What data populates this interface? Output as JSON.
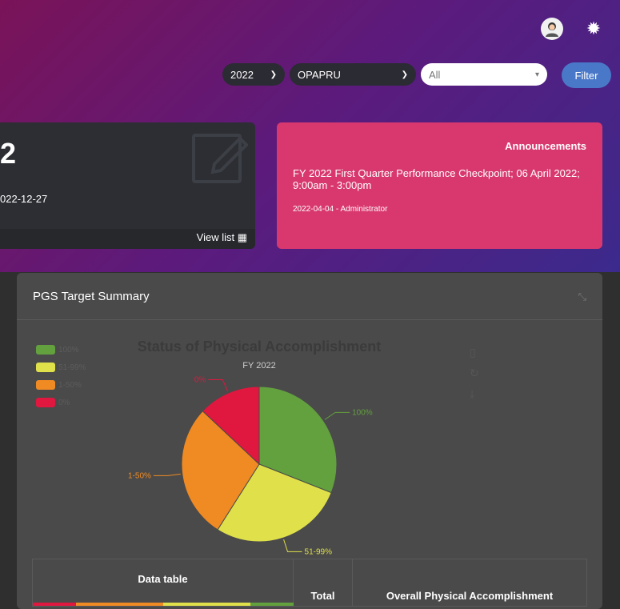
{
  "header": {
    "year_select": "2022",
    "unit_select": "OPAPRU",
    "filter_all": "All",
    "filter_button": "Filter"
  },
  "card_dark": {
    "big_text": "2",
    "date": "022-12-27",
    "view_list": "View list ▦"
  },
  "announcement": {
    "title": "Announcements",
    "message": "FY 2022 First Quarter Performance Checkpoint; 06 April 2022; 9:00am - 3:00pm",
    "meta": "2022-04-04 - Administrator"
  },
  "panel": {
    "title": "PGS Target Summary"
  },
  "chart_data": {
    "type": "pie",
    "title": "Status of Physical Accomplishment",
    "subtitle": "FY 2022",
    "legend": [
      "100%",
      "51-99%",
      "1-50%",
      "0%"
    ],
    "slices": [
      {
        "label": "100%",
        "value": 31,
        "color": "#63a03e"
      },
      {
        "label": "51-99%",
        "value": 28,
        "color": "#dfe04a"
      },
      {
        "label": "1-50%",
        "value": 28,
        "color": "#f08a23"
      },
      {
        "label": "0%",
        "value": 13,
        "color": "#e0173f"
      }
    ],
    "legend_position": "top-left"
  },
  "data_table": {
    "header_1": "Data table",
    "header_2": "Total",
    "header_3": "Overall Physical Accomplishment"
  }
}
